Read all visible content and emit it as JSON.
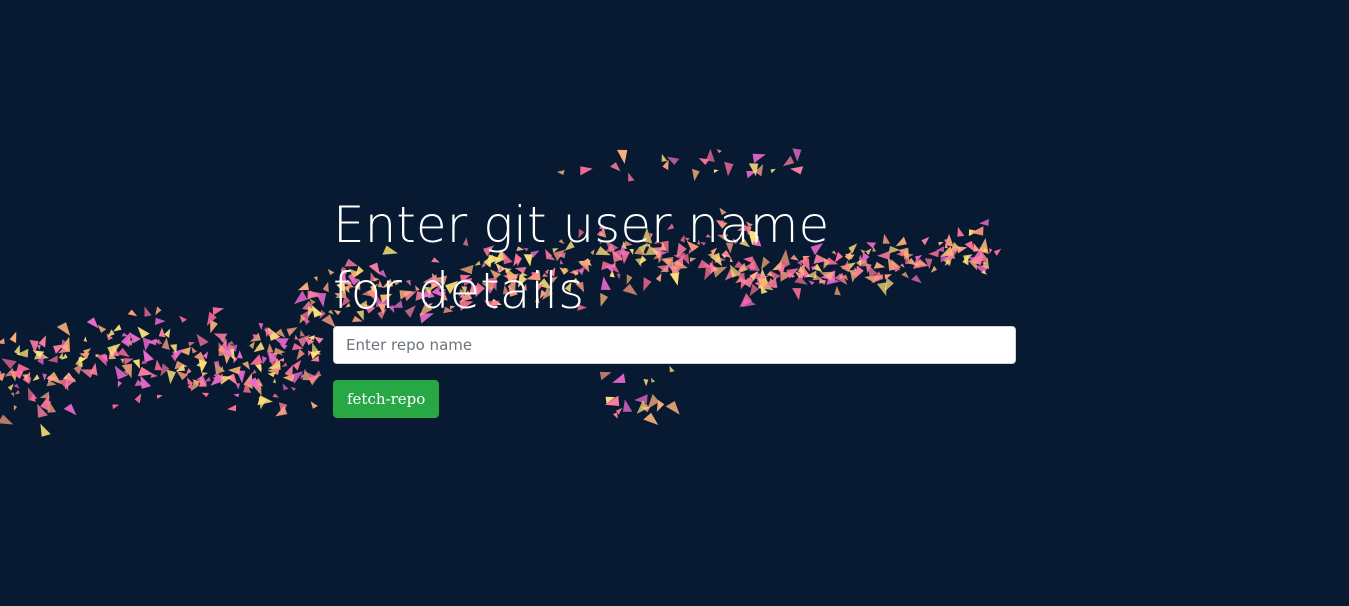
{
  "page": {
    "background_color": "#081a31"
  },
  "main": {
    "heading": "Enter git user name for details",
    "input": {
      "placeholder": "Enter repo name",
      "value": ""
    },
    "button": {
      "label": "fetch-repo",
      "color": "#28a745"
    }
  },
  "decoration": {
    "particle_colors": [
      "#ff7fa0",
      "#ff9f80",
      "#f06cd0",
      "#ffb27a",
      "#ffe27a",
      "#ff6f9a"
    ]
  }
}
